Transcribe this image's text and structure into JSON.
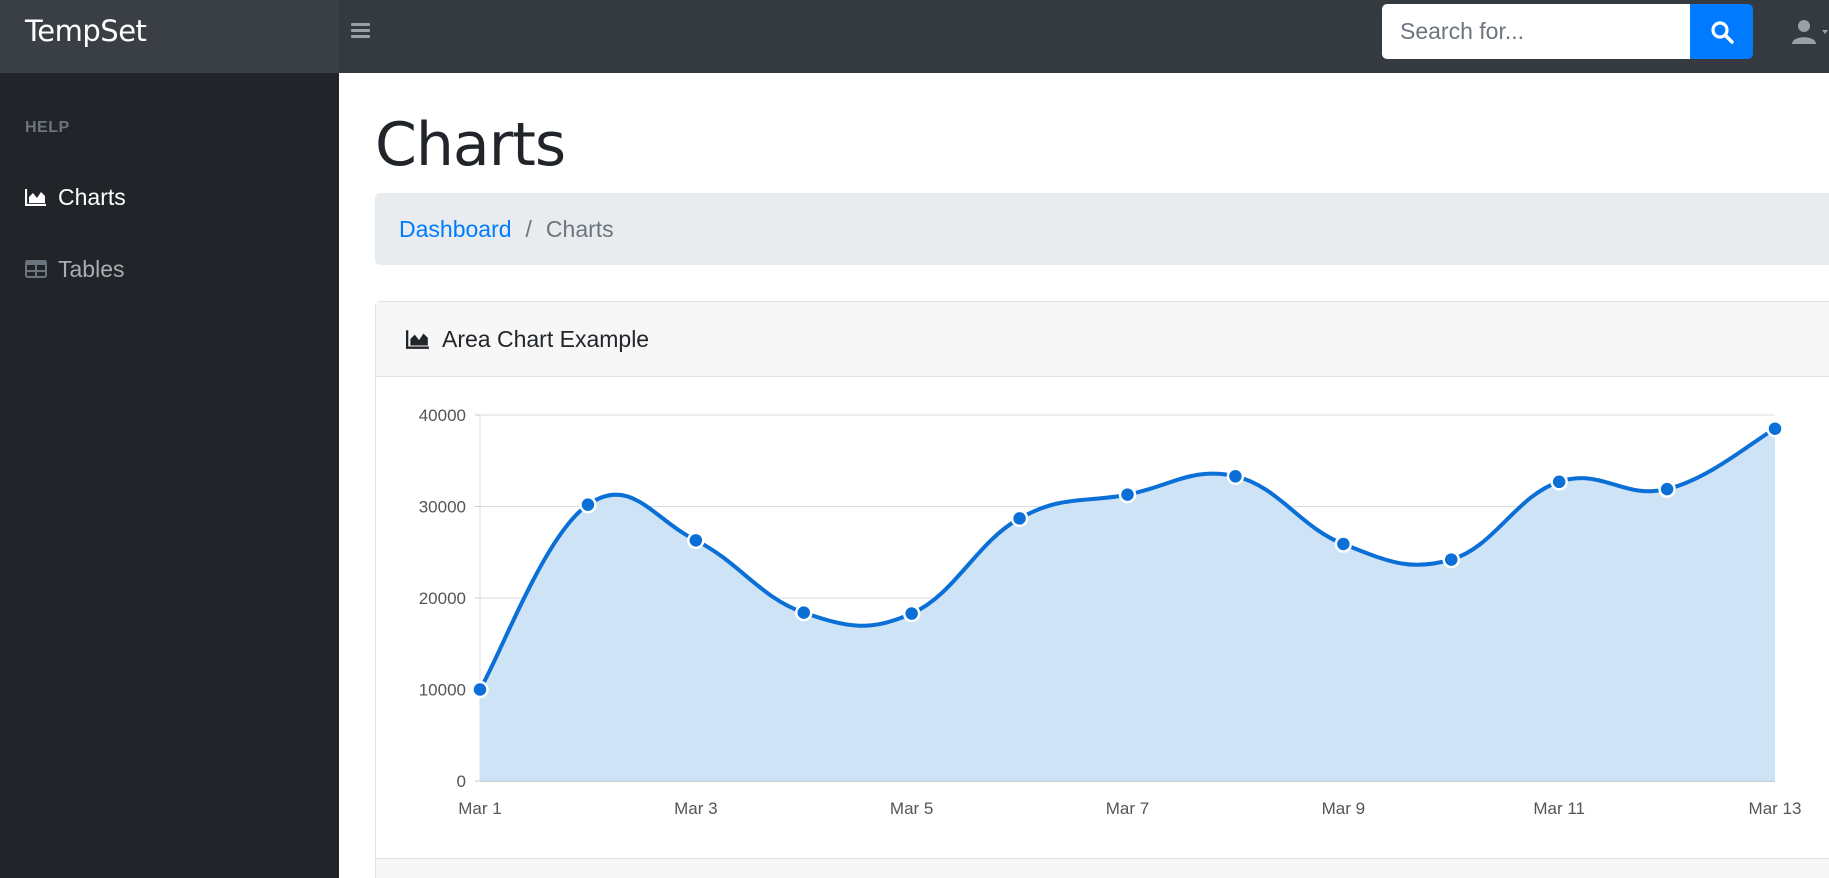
{
  "navbar": {
    "brand": "TempSet",
    "search_placeholder": "Search for..."
  },
  "sidebar": {
    "heading": "HELP",
    "items": [
      {
        "label": "Charts",
        "icon": "area-chart-icon",
        "active": true
      },
      {
        "label": "Tables",
        "icon": "table-icon",
        "active": false
      }
    ]
  },
  "page": {
    "title": "Charts",
    "breadcrumb": {
      "link": "Dashboard",
      "separator": "/",
      "current": "Charts"
    }
  },
  "card": {
    "header": "Area Chart Example"
  },
  "colors": {
    "line": "#0a6fd6",
    "fill": "#cce1f6",
    "accent": "#007bff"
  },
  "chart_data": {
    "type": "area",
    "title": "",
    "xlabel": "",
    "ylabel": "",
    "ylim": [
      0,
      40000
    ],
    "yticks": [
      0,
      10000,
      20000,
      30000,
      40000
    ],
    "categories": [
      "Mar 1",
      "Mar 2",
      "Mar 3",
      "Mar 4",
      "Mar 5",
      "Mar 6",
      "Mar 7",
      "Mar 8",
      "Mar 9",
      "Mar 10",
      "Mar 11",
      "Mar 12",
      "Mar 13"
    ],
    "xtick_labels": [
      "Mar 1",
      "",
      "Mar 3",
      "",
      "Mar 5",
      "",
      "Mar 7",
      "",
      "Mar 9",
      "",
      "Mar 11",
      "",
      "Mar 13"
    ],
    "series": [
      {
        "values": [
          10000,
          30200,
          26300,
          18400,
          18300,
          28700,
          31300,
          33300,
          25900,
          24200,
          32700,
          31900,
          38500
        ]
      }
    ],
    "grid": true
  }
}
